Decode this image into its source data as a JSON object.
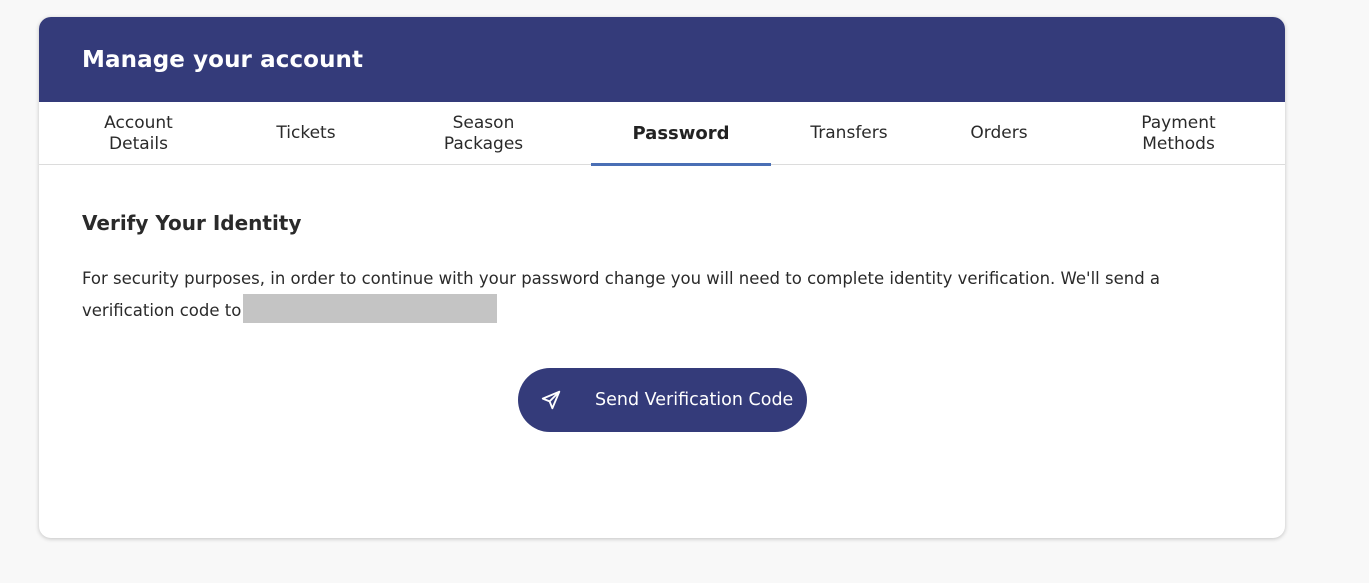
{
  "header": {
    "title": "Manage your account"
  },
  "tabs": [
    {
      "label": "Account Details",
      "active": false
    },
    {
      "label": "Tickets",
      "active": false
    },
    {
      "label": "Season Packages",
      "active": false
    },
    {
      "label": "Password",
      "active": true
    },
    {
      "label": "Transfers",
      "active": false
    },
    {
      "label": "Orders",
      "active": false
    },
    {
      "label": "Payment Methods",
      "active": false
    }
  ],
  "main": {
    "section_title": "Verify Your Identity",
    "description": "For security purposes, in order to continue with your password change you will need to complete identity verification. We'll send a verification code to",
    "send_button_label": "Send Verification Code",
    "send_icon": "paper-plane-icon"
  },
  "colors": {
    "header_bg": "#343b7a",
    "button_bg": "#343b7a",
    "active_tab_underline": "#4a6fb5",
    "redacted": "#c4c4c4"
  }
}
